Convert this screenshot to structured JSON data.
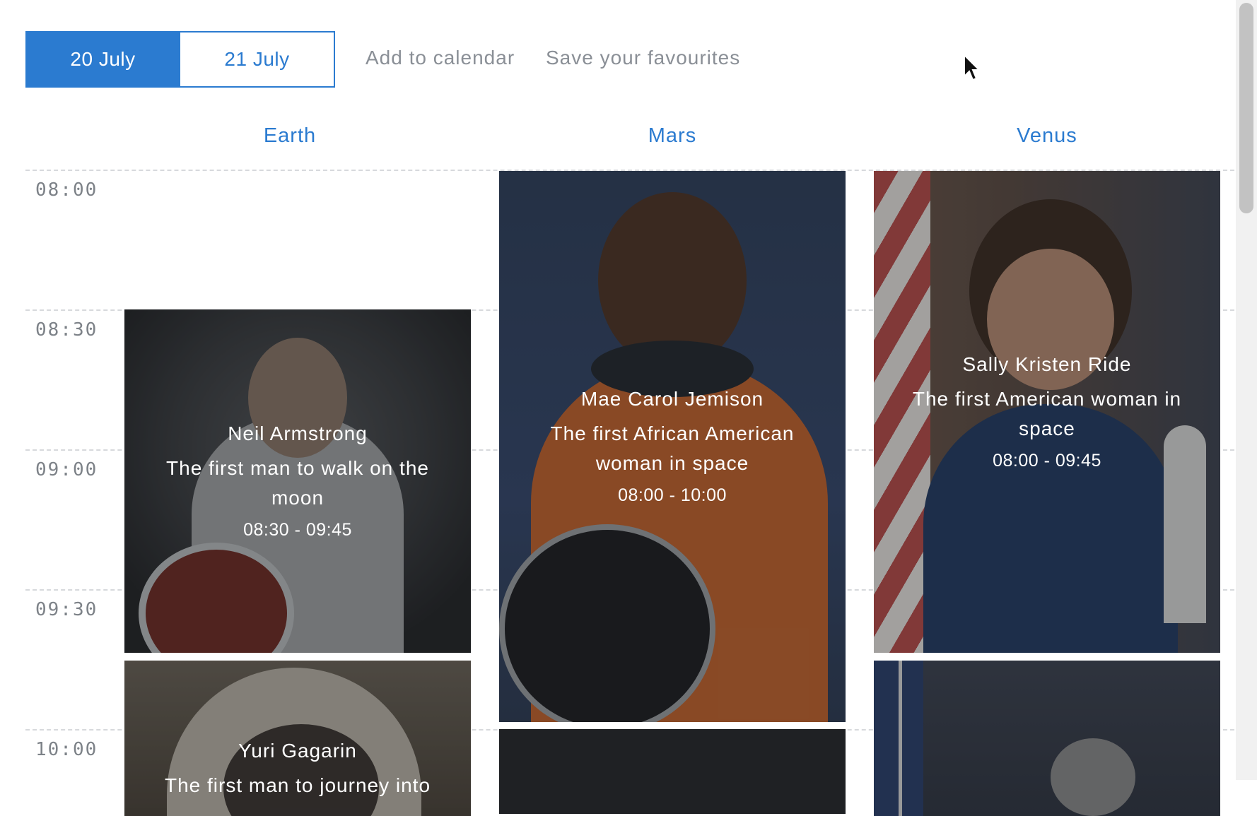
{
  "toolbar": {
    "dates": [
      {
        "label": "20 July",
        "active": true
      },
      {
        "label": "21 July",
        "active": false
      }
    ],
    "add_to_calendar": "Add to calendar",
    "save_favourites": "Save your favourites"
  },
  "columns": [
    "Earth",
    "Mars",
    "Venus"
  ],
  "times": [
    "08:00",
    "08:30",
    "09:00",
    "09:30",
    "10:00"
  ],
  "sessions": [
    {
      "name": "Neil Armstrong",
      "description": "The first man to walk on the moon",
      "time": "08:30 - 09:45"
    },
    {
      "name": "Mae Carol Jemison",
      "description": "The first African American woman in space",
      "time": "08:00 - 10:00"
    },
    {
      "name": "Sally Kristen Ride",
      "description": "The first American woman in space",
      "time": "08:00 - 09:45"
    },
    {
      "name": "Yuri Gagarin",
      "description": "The first man to journey into",
      "time": ""
    }
  ],
  "colors": {
    "accent": "#2b7bd0",
    "muted_text": "#8a8f96",
    "grid_line": "#d7d9dc"
  },
  "icons": [
    "mouse-pointer-icon"
  ]
}
